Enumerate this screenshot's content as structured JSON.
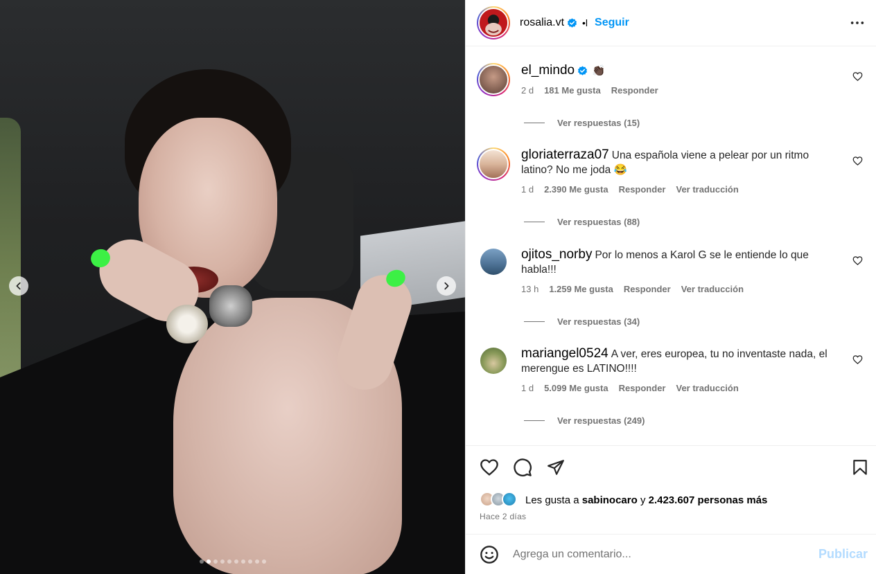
{
  "post": {
    "author": "rosalia.vt",
    "separator": "•l",
    "follow_label": "Seguir",
    "carousel": {
      "total_slides": 10,
      "active_slide": 2
    }
  },
  "comments": [
    {
      "username": "el_mindo",
      "verified": true,
      "text": "👏🏿",
      "time": "2 d",
      "likes": "181 Me gusta",
      "reply_label": "Responder",
      "translate_label": "",
      "view_replies": "Ver respuestas (15)"
    },
    {
      "username": "gloriaterraza07",
      "verified": false,
      "text": "Una española viene a pelear por un ritmo latino? No me joda 😂",
      "time": "1 d",
      "likes": "2.390 Me gusta",
      "reply_label": "Responder",
      "translate_label": "Ver traducción",
      "view_replies": "Ver respuestas (88)"
    },
    {
      "username": "ojitos_norby",
      "verified": false,
      "text": "Por lo menos a Karol G se le entiende lo que habla!!!",
      "time": "13 h",
      "likes": "1.259 Me gusta",
      "reply_label": "Responder",
      "translate_label": "Ver traducción",
      "view_replies": "Ver respuestas (34)"
    },
    {
      "username": "mariangel0524",
      "verified": false,
      "text": "A ver, eres europea, tu no inventaste nada, el merengue es LATINO!!!!",
      "time": "1 d",
      "likes": "5.099 Me gusta",
      "reply_label": "Responder",
      "translate_label": "Ver traducción",
      "view_replies": "Ver respuestas (249)"
    }
  ],
  "likes": {
    "prefix": "Les gusta a",
    "user": "sabinocaro",
    "connector": "y",
    "others": "2.423.607 personas más"
  },
  "time_ago": "Hace 2 días",
  "comment_input": {
    "placeholder": "Agrega un comentario...",
    "publish_label": "Publicar"
  },
  "icons": {
    "more": "more-options-icon",
    "like": "heart-icon",
    "comment": "comment-icon",
    "share": "share-icon",
    "save": "bookmark-icon",
    "emoji": "emoji-icon"
  },
  "colors": {
    "accent": "#0095f6",
    "publish_disabled": "#b3dbff",
    "verified": "#0095f6",
    "nail": "#3cf045"
  }
}
